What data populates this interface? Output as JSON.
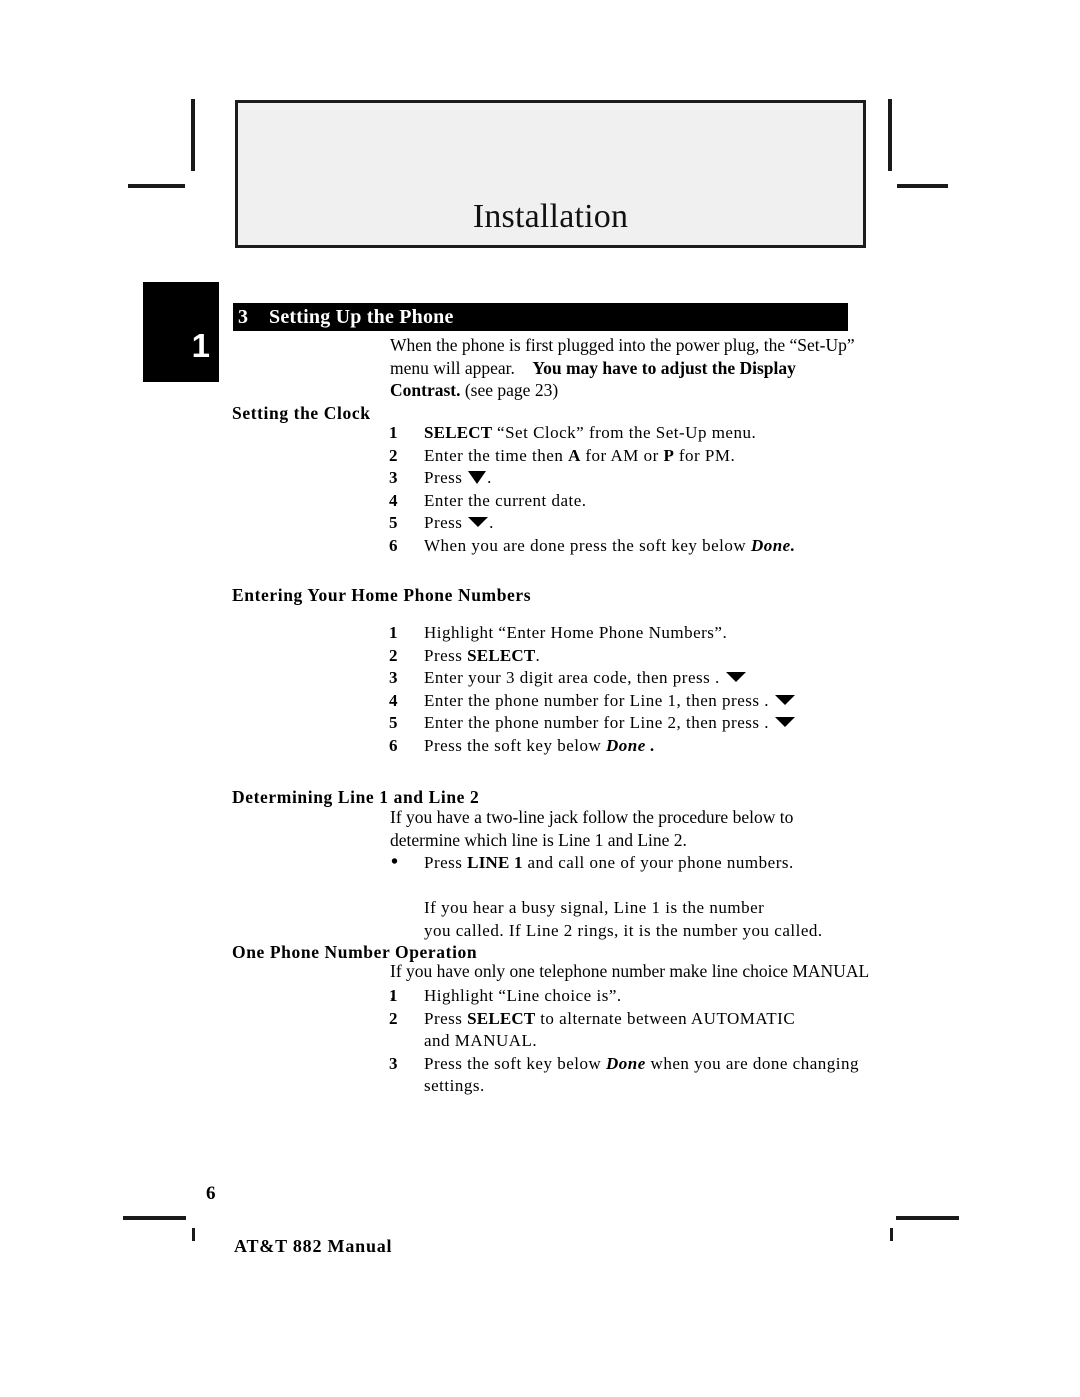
{
  "running_head": {
    "title": "Installation"
  },
  "chapter_tab": {
    "number": "1"
  },
  "section": {
    "number": "3",
    "title": "Setting Up the Phone",
    "intro": {
      "plain_1": "When the phone is first plugged into the power plug, the ",
      "plain_2": "“Set-Up” menu will appear. ",
      "bold_1": "You may have to adjust the Display Contrast.",
      "plain_3": " (see page 23)"
    }
  },
  "subsections": [
    {
      "heading": "Setting the Clock",
      "steps": [
        {
          "num": "1",
          "pre": "",
          "bold": "SELECT",
          "post": " “Set Clock” from the Set-Up menu."
        },
        {
          "num": "2",
          "pre": "Enter the time then ",
          "bold": "A",
          "post": " for AM or ",
          "bold2": "P",
          "post2": " for PM."
        },
        {
          "num": "3",
          "pre": "Press ",
          "icon": "down-triangle-icon",
          "post": "."
        },
        {
          "num": "4",
          "pre": "Enter the current date.",
          "post": ""
        },
        {
          "num": "5",
          "pre": "Press ",
          "icon": "down-triangle-icon",
          "post": "."
        },
        {
          "num": "6",
          "pre": "When you are done press the soft key below ",
          "emph": "Done.",
          "post": ""
        }
      ]
    },
    {
      "heading": "Entering Your Home Phone Numbers",
      "steps": [
        {
          "num": "1",
          "pre": "Highlight “Enter Home Phone Numbers”.",
          "post": ""
        },
        {
          "num": "2",
          "pre": "Press ",
          "bold": "SELECT",
          "post": "."
        },
        {
          "num": "3",
          "pre": "Enter your 3 digit area code, then press",
          "mid": "  .  ",
          "icon": "down-triangle-icon",
          "post": ""
        },
        {
          "num": "4",
          "pre": "Enter the phone number for Line 1, then press",
          "mid": "   .  ",
          "icon": "down-triangle-icon",
          "post": ""
        },
        {
          "num": "5",
          "pre": "Enter the phone number for Line 2, then press",
          "mid": "  .  ",
          "icon": "down-triangle-icon",
          "post": ""
        },
        {
          "num": "6",
          "pre": "Press the soft key below ",
          "emph": "Done .",
          "post": ""
        }
      ]
    },
    {
      "heading": "Determining Line 1 and Line 2",
      "intro": "If you have a two-line jack follow the procedure below to determine which line is Line 1 and Line 2.",
      "steps": [
        {
          "num": "•",
          "bullet": true,
          "pre": "Press ",
          "bold": "LINE 1",
          "post": " and call one of your phone numbers."
        },
        {
          "num": "",
          "blank": true
        },
        {
          "num": "",
          "pre": "If you hear a busy signal, Line 1 is the number",
          "post": ""
        },
        {
          "num": "",
          "pre": "you called.  If Line 2 rings, it is the number you called.",
          "post": ""
        }
      ]
    },
    {
      "heading": "One Phone Number Operation",
      "intro": "If you have only one telephone number make line choice MANUAL .",
      "steps": [
        {
          "num": "1",
          "pre": "Highlight “Line choice is”.",
          "post": ""
        },
        {
          "num": "2",
          "pre": "Press ",
          "bold": "SELECT",
          "post": " to alternate between AUTOMATIC"
        },
        {
          "num": "",
          "pre": "and MANUAL.",
          "post": ""
        },
        {
          "num": "3",
          "pre": "Press the soft key below ",
          "emph": "Done",
          "post": " when you are done changing"
        },
        {
          "num": "",
          "pre": "settings.",
          "post": ""
        }
      ]
    }
  ],
  "footer": {
    "page_number": "6",
    "manual_title": "AT&T 882 Manual"
  },
  "colors": {
    "head_box_fill": "#f0f0f0",
    "bar_fill": "#000000",
    "bar_text": "#ffffff",
    "body_text": "#000000",
    "crop_mark": "#1a1a1a"
  }
}
